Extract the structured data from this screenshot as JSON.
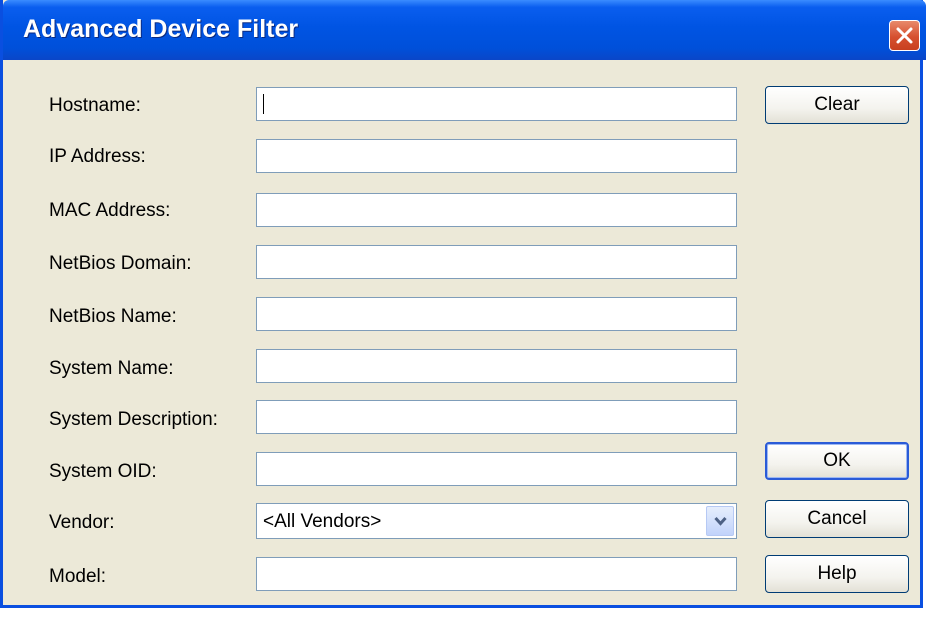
{
  "window": {
    "title": "Advanced Device Filter",
    "title_bar_color": "#0054E3",
    "close_icon": "close-x-icon"
  },
  "fields": {
    "hostname": {
      "label": "Hostname:",
      "value": ""
    },
    "ip_address": {
      "label": "IP Address:",
      "value": ""
    },
    "mac_address": {
      "label": "MAC Address:",
      "value": ""
    },
    "netbios_domain": {
      "label": "NetBios Domain:",
      "value": ""
    },
    "netbios_name": {
      "label": "NetBios Name:",
      "value": ""
    },
    "system_name": {
      "label": "System Name:",
      "value": ""
    },
    "system_description": {
      "label": "System Description:",
      "value": ""
    },
    "system_oid": {
      "label": "System OID:",
      "value": ""
    },
    "vendor": {
      "label": "Vendor:",
      "selected": "<All Vendors>"
    },
    "model": {
      "label": "Model:",
      "value": ""
    }
  },
  "buttons": {
    "clear": "Clear",
    "ok": "OK",
    "cancel": "Cancel",
    "help": "Help"
  },
  "icons": {
    "dropdown": "chevron-down-icon"
  }
}
